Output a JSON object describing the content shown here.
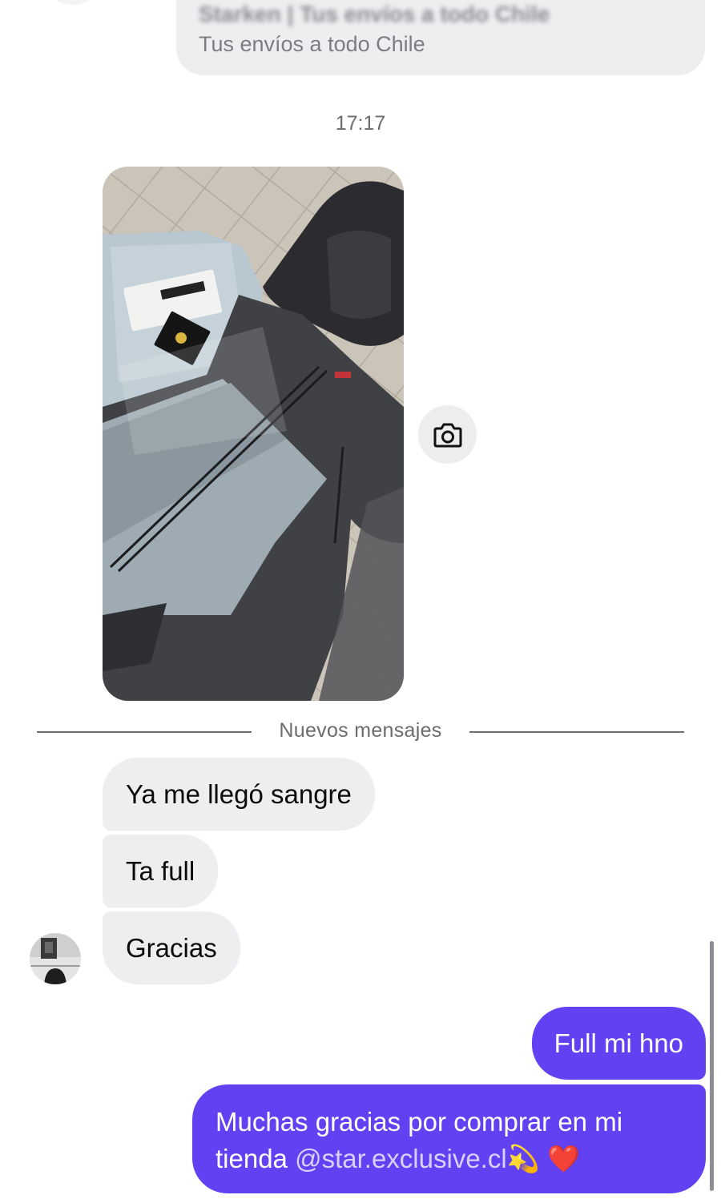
{
  "link_preview": {
    "title": "Starken | Tus envíos a todo Chile",
    "subtitle": "Tus envíos a todo Chile"
  },
  "timestamp": "17:17",
  "photo": {
    "icon": "camera-icon"
  },
  "new_messages_divider": "Nuevos mensajes",
  "incoming_messages": [
    {
      "text": "Ya me llegó sangre"
    },
    {
      "text": "Ta full"
    },
    {
      "text": "Gracias"
    }
  ],
  "outgoing_messages": [
    {
      "text": "Full mi hno"
    },
    {
      "text_before": "Muchas gracias por comprar en mi tienda ",
      "handle": "@star.exclusive.cl",
      "emojis": "💫 ❤️"
    }
  ],
  "colors": {
    "outgoing_bubble": "#6141f1",
    "incoming_bubble": "#eeeef1",
    "muted_text": "#6b6b70"
  }
}
